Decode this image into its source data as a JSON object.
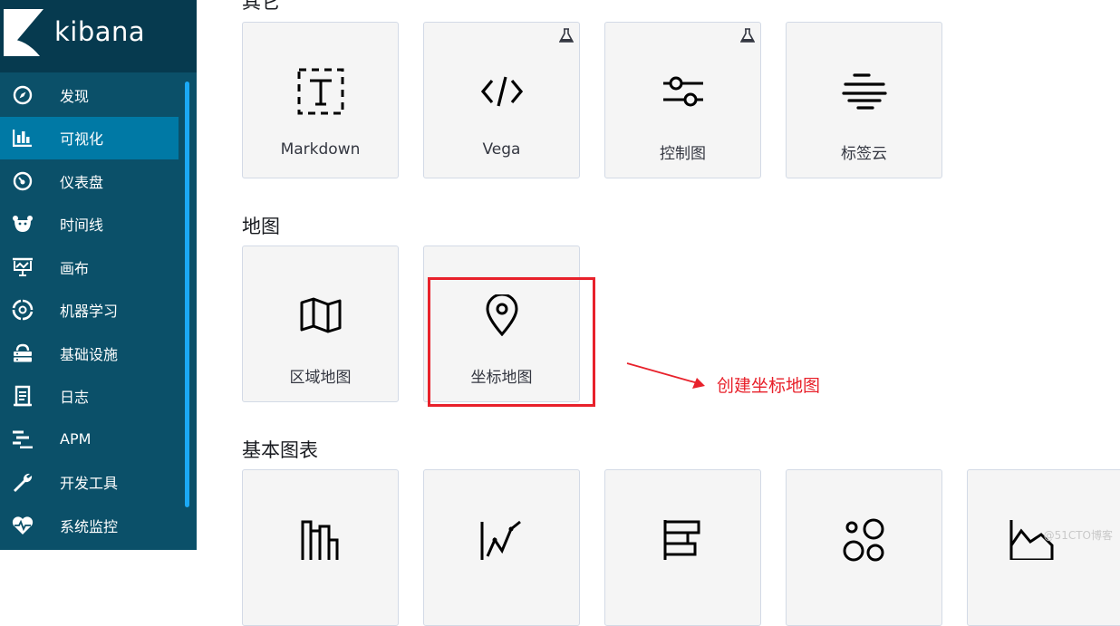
{
  "sidebar": {
    "brand": "kibana",
    "items": [
      {
        "label": "发现",
        "icon": "compass-icon",
        "active": false
      },
      {
        "label": "可视化",
        "icon": "bar-chart-icon",
        "active": true
      },
      {
        "label": "仪表盘",
        "icon": "dashboard-icon",
        "active": false
      },
      {
        "label": "时间线",
        "icon": "timeline-icon",
        "active": false
      },
      {
        "label": "画布",
        "icon": "canvas-icon",
        "active": false
      },
      {
        "label": "机器学习",
        "icon": "machine-learning-icon",
        "active": false
      },
      {
        "label": "基础设施",
        "icon": "infrastructure-icon",
        "active": false
      },
      {
        "label": "日志",
        "icon": "logs-icon",
        "active": false
      },
      {
        "label": "APM",
        "icon": "apm-icon",
        "active": false
      },
      {
        "label": "开发工具",
        "icon": "wrench-icon",
        "active": false
      },
      {
        "label": "系统监控",
        "icon": "heartbeat-icon",
        "active": false
      }
    ]
  },
  "main": {
    "sections": {
      "other": {
        "title": "其它",
        "tiles": [
          {
            "label": "Markdown",
            "icon": "markdown-icon",
            "beta": false
          },
          {
            "label": "Vega",
            "icon": "code-icon",
            "beta": true
          },
          {
            "label": "控制图",
            "icon": "controls-icon",
            "beta": true
          },
          {
            "label": "标签云",
            "icon": "tag-cloud-icon",
            "beta": false
          }
        ]
      },
      "maps": {
        "title": "地图",
        "tiles": [
          {
            "label": "区域地图",
            "icon": "map-icon"
          },
          {
            "label": "坐标地图",
            "icon": "map-pin-icon"
          }
        ]
      },
      "basic": {
        "title": "基本图表",
        "tiles": [
          {
            "icon": "vertical-bar-icon"
          },
          {
            "icon": "line-chart-icon"
          },
          {
            "icon": "horizontal-bar-icon"
          },
          {
            "icon": "bubbles-icon"
          },
          {
            "icon": "area-chart-icon"
          }
        ]
      }
    }
  },
  "annotation": {
    "text": "创建坐标地图",
    "color": "#e8212b"
  },
  "watermark": "@51CTO博客",
  "colors": {
    "sidebar_bg": "#0b5069",
    "brand_bg": "#063a4f",
    "active_item": "#0079a5",
    "accent": "#1ba9f5"
  }
}
